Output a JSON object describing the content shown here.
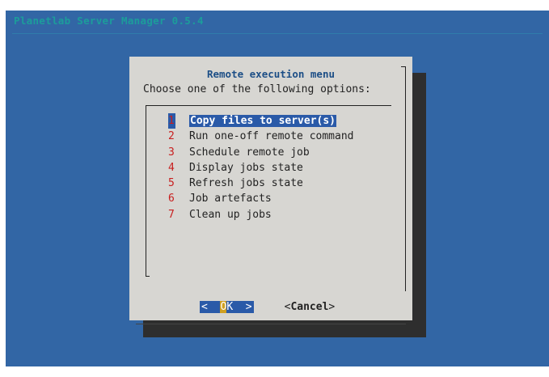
{
  "backtitle": "Planetlab Server Manager 0.5.4",
  "dialog": {
    "title": "Remote execution menu",
    "prompt": "Choose one of the following options:"
  },
  "menu": {
    "items": [
      {
        "key": "1",
        "label": "Copy files to server(s)",
        "selected": true
      },
      {
        "key": "2",
        "label": "Run one-off remote command",
        "selected": false
      },
      {
        "key": "3",
        "label": "Schedule remote job",
        "selected": false
      },
      {
        "key": "4",
        "label": "Display jobs state",
        "selected": false
      },
      {
        "key": "5",
        "label": "Refresh jobs state",
        "selected": false
      },
      {
        "key": "6",
        "label": "Job artefacts",
        "selected": false
      },
      {
        "key": "7",
        "label": "Clean up jobs",
        "selected": false
      }
    ]
  },
  "buttons": {
    "ok_left": "<",
    "ok_hot": "O",
    "ok_rest": "K",
    "ok_right": ">",
    "cancel_left": "<",
    "cancel_label": "Cancel",
    "cancel_right": ">"
  },
  "colors": {
    "screen_bg": "#3266a5",
    "dialog_bg": "#d7d6d2",
    "highlight": "#2a5aa8",
    "hotkey": "#c81e1e",
    "backtitle": "#1c9d9b"
  }
}
